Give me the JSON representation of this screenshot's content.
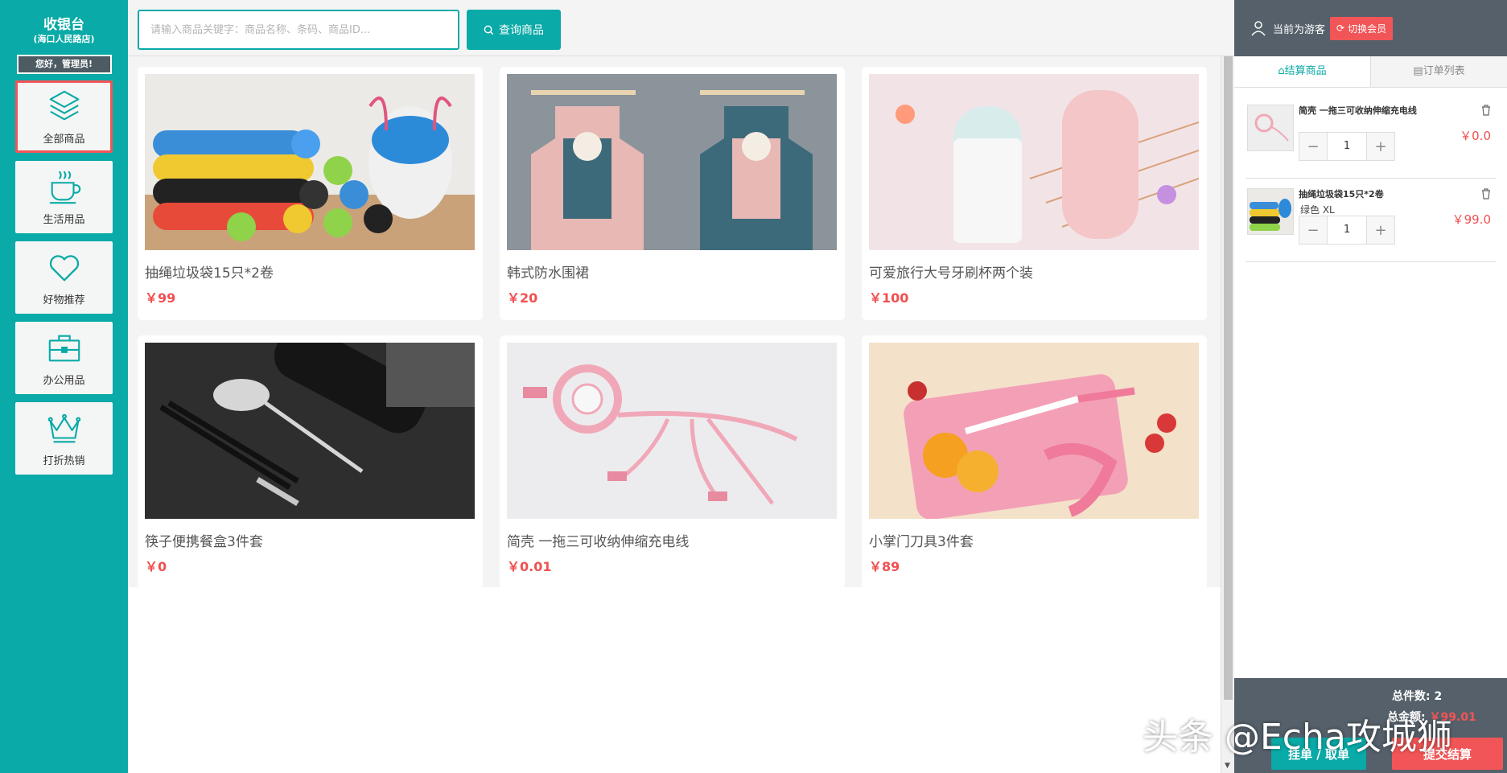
{
  "sidebar": {
    "title": "收银台",
    "subtitle": "(海口人民路店)",
    "greeting": "您好，管理员!",
    "items": [
      {
        "label": "全部商品",
        "icon": "layers-icon"
      },
      {
        "label": "生活用品",
        "icon": "coffee-cup-icon"
      },
      {
        "label": "好物推荐",
        "icon": "heart-icon"
      },
      {
        "label": "办公用品",
        "icon": "briefcase-icon"
      },
      {
        "label": "打折热销",
        "icon": "crown-icon"
      }
    ]
  },
  "search": {
    "placeholder": "请输入商品关键字：商品名称、条码、商品ID...",
    "button_label": "查询商品"
  },
  "products": [
    {
      "title": "抽绳垃圾袋15只*2卷",
      "price": "￥99"
    },
    {
      "title": "韩式防水围裙",
      "price": "￥20"
    },
    {
      "title": "可爱旅行大号牙刷杯两个装",
      "price": "￥100"
    },
    {
      "title": "筷子便携餐盒3件套",
      "price": "￥0"
    },
    {
      "title": "简壳 一拖三可收纳伸缩充电线",
      "price": "￥0.01"
    },
    {
      "title": "小掌门刀具3件套",
      "price": "￥89"
    }
  ],
  "right_panel": {
    "user_label": "当前为游客",
    "switch_label": "切换会员",
    "tabs": [
      "结算商品",
      "订单列表"
    ],
    "cart": [
      {
        "name": "简壳 一拖三可收纳伸缩充电线",
        "spec": "",
        "qty": "1",
        "price": "￥0.0"
      },
      {
        "name": "抽绳垃圾袋15只*2卷",
        "spec": "绿色  XL",
        "qty": "1",
        "price": "￥99.0"
      }
    ],
    "summary": {
      "count_label": "总件数:",
      "count_value": "2",
      "total_label": "总金额:",
      "total_value": "￥99.01",
      "hold_label": "挂单 / 取单",
      "submit_label": "提交结算"
    }
  },
  "watermark": "头条 @Echa攻城狮",
  "colors": {
    "primary": "#09aaa7",
    "danger": "#f25557",
    "panel": "#55606a"
  }
}
